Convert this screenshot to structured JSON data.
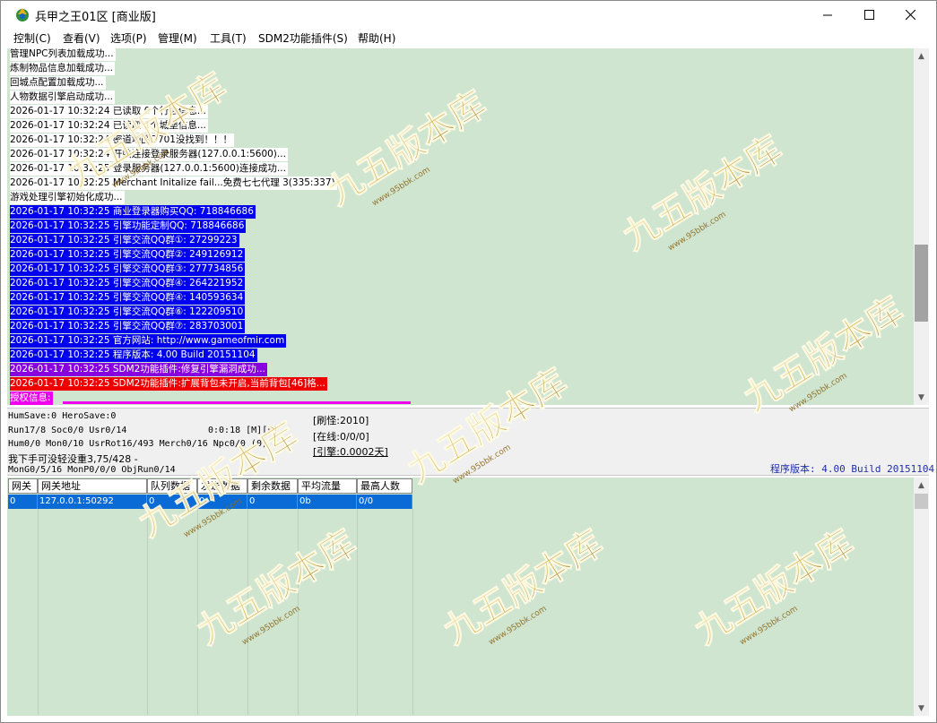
{
  "window": {
    "title": "兵甲之王01区 [商业版]"
  },
  "menu": [
    "控制(C)",
    "查看(V)",
    "选项(P)",
    "管理(M)",
    "工具(T)",
    "SDM2功能插件(S)",
    "帮助(H)"
  ],
  "log_lines": [
    {
      "text": "管理NPC列表加载成功...",
      "bg": "#ffffff",
      "fg": "#000000"
    },
    {
      "text": "炼制物品信息加载成功...",
      "bg": "#ffffff",
      "fg": "#000000"
    },
    {
      "text": "回城点配置加载成功...",
      "bg": "#ffffff",
      "fg": "#000000"
    },
    {
      "text": "人物数据引擎启动成功...",
      "bg": "#ffffff",
      "fg": "#000000"
    },
    {
      "text": "2026-01-17 10:32:24 已读取 0个行会信息...",
      "bg": "#ffffff",
      "fg": "#000000"
    },
    {
      "text": "2026-01-17 10:32:24 已读取 1个城堡信息...",
      "bg": "#ffffff",
      "fg": "#000000"
    },
    {
      "text": "2026-01-17 10:32:24 密道地图D701没找到！！！",
      "bg": "#ffffff",
      "fg": "#000000"
    },
    {
      "text": "2026-01-17 10:32:24 开始连接登录服务器(127.0.0.1:5600)...",
      "bg": "#ffffff",
      "fg": "#000000"
    },
    {
      "text": "2026-01-17 10:32:25 登录服务器(127.0.0.1:5600)连接成功...",
      "bg": "#ffffff",
      "fg": "#000000"
    },
    {
      "text": "2026-01-17 10:32:25 Merchant Initalize fail...免费七七代理 3(335:337)",
      "bg": "#ffffff",
      "fg": "#000000"
    },
    {
      "text": "游戏处理引擎初始化成功...",
      "bg": "#ffffff",
      "fg": "#000000"
    },
    {
      "text": "2026-01-17 10:32:25 商业登录器购买QQ: 718846686",
      "bg": "#0000ee",
      "fg": "#ffffff"
    },
    {
      "text": "2026-01-17 10:32:25 引擎功能定制QQ: 718846686",
      "bg": "#0000ee",
      "fg": "#ffffff"
    },
    {
      "text": "2026-01-17 10:32:25 引擎交流QQ群①: 27299223",
      "bg": "#0000ee",
      "fg": "#ffffff"
    },
    {
      "text": "2026-01-17 10:32:25 引擎交流QQ群②: 249126912",
      "bg": "#0000ee",
      "fg": "#ffffff"
    },
    {
      "text": "2026-01-17 10:32:25 引擎交流QQ群③: 277734856",
      "bg": "#0000ee",
      "fg": "#ffffff"
    },
    {
      "text": "2026-01-17 10:32:25 引擎交流QQ群④: 264221952",
      "bg": "#0000ee",
      "fg": "#ffffff"
    },
    {
      "text": "2026-01-17 10:32:25 引擎交流QQ群④: 140593634",
      "bg": "#0000ee",
      "fg": "#ffffff"
    },
    {
      "text": "2026-01-17 10:32:25 引擎交流QQ群⑥: 122209510",
      "bg": "#0000ee",
      "fg": "#ffffff"
    },
    {
      "text": "2026-01-17 10:32:25 引擎交流QQ群⑦: 283703001",
      "bg": "#0000ee",
      "fg": "#ffffff"
    },
    {
      "text": "2026-01-17 10:32:25 官方网站: http://www.gameofmir.com",
      "bg": "#0000ee",
      "fg": "#ffffff"
    },
    {
      "text": "2026-01-17 10:32:25 程序版本: 4.00 Build 20151104",
      "bg": "#0000ee",
      "fg": "#ffffff"
    },
    {
      "text": "2026-01-17 10:32:25 SDM2功能插件:修复引擎漏洞成功...",
      "bg": "#8800dd",
      "fg": "#ffffff"
    },
    {
      "text": "2026-01-17 10:32:25 SDM2功能插件:扩展背包未开启,当前背包[46]格...",
      "bg": "#ee0000",
      "fg": "#ffffff"
    },
    {
      "text": "授权信息:",
      "bg": "#ee00ee",
      "fg": "#ffffff"
    }
  ],
  "status": {
    "line1": "HumSave:0 HeroSave:0",
    "line2": "Run17/8 Soc0/0 Usr0/14",
    "time": "0:0:18 [M][F]",
    "line3": "Hum0/0 Mon0/10 UsrRot16/493 Merch0/16 Npc0/0 (0)",
    "line4": "我下手可没轻没重3,75/428 -",
    "line5": "MonG0/5/16 MonP0/0/0 ObjRun0/14",
    "refresh": "[刷怪:2010]",
    "online": "[在线:0/0/0]",
    "engine": "[引擎:0.0002天]",
    "version": "程序版本: 4.00 Build 20151104"
  },
  "grid": {
    "headers": [
      "网关",
      "网关地址",
      "队列数据",
      "发送数据",
      "剩余数据",
      "平均流量",
      "最高人数"
    ],
    "rows": [
      [
        "0",
        "127.0.0.1:50292",
        "0",
        "0",
        "0",
        "0b",
        "0/0"
      ]
    ]
  },
  "watermark": {
    "text": "九五版本库",
    "url": "www.95bbk.com"
  }
}
